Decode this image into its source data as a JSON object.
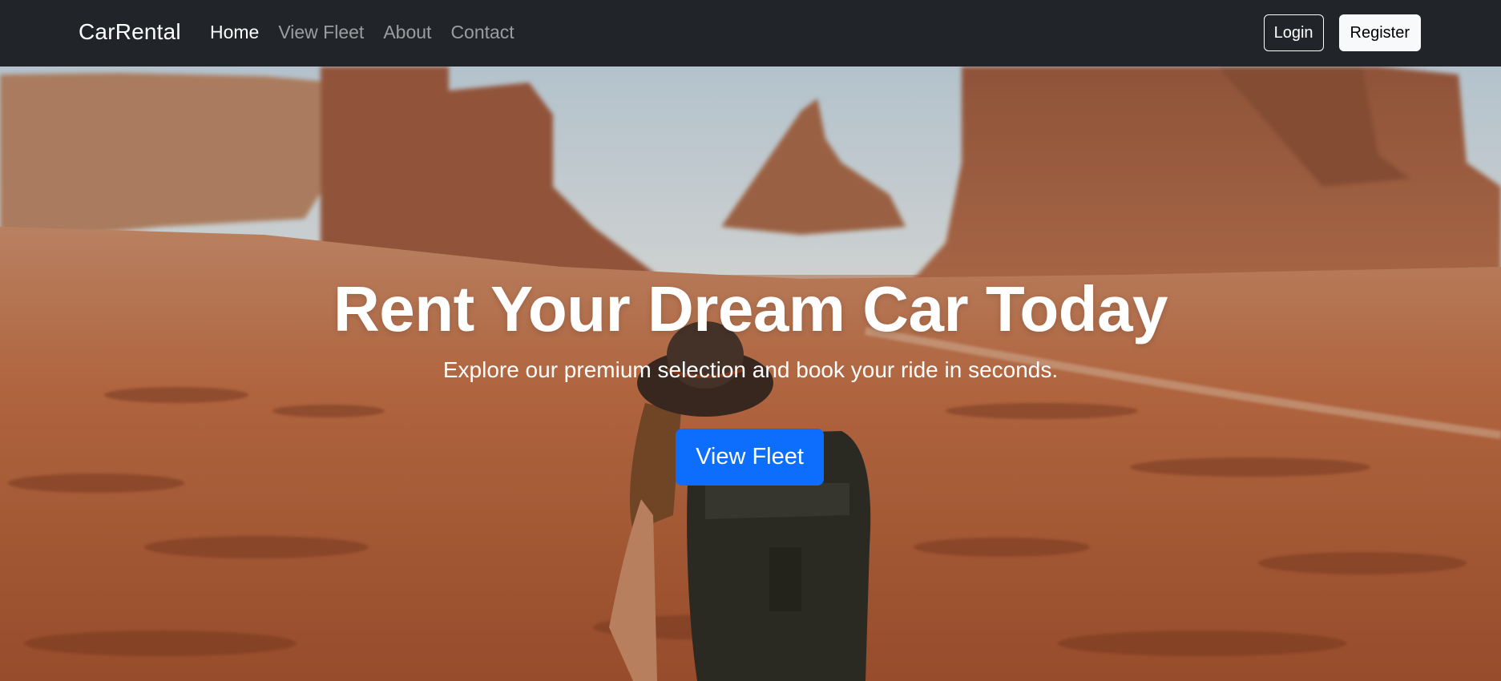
{
  "navbar": {
    "brand": "CarRental",
    "links": [
      {
        "label": "Home",
        "active": true
      },
      {
        "label": "View Fleet",
        "active": false
      },
      {
        "label": "About",
        "active": false
      },
      {
        "label": "Contact",
        "active": false
      }
    ],
    "login_label": "Login",
    "register_label": "Register"
  },
  "hero": {
    "title": "Rent Your Dream Car Today",
    "subtitle": "Explore our premium selection and book your ride in seconds.",
    "cta_label": "View Fleet",
    "background": "desert-landscape-traveler-photo"
  },
  "colors": {
    "navbar_bg": "#212529",
    "primary": "#0d6efd",
    "light": "#f8f9fa"
  }
}
